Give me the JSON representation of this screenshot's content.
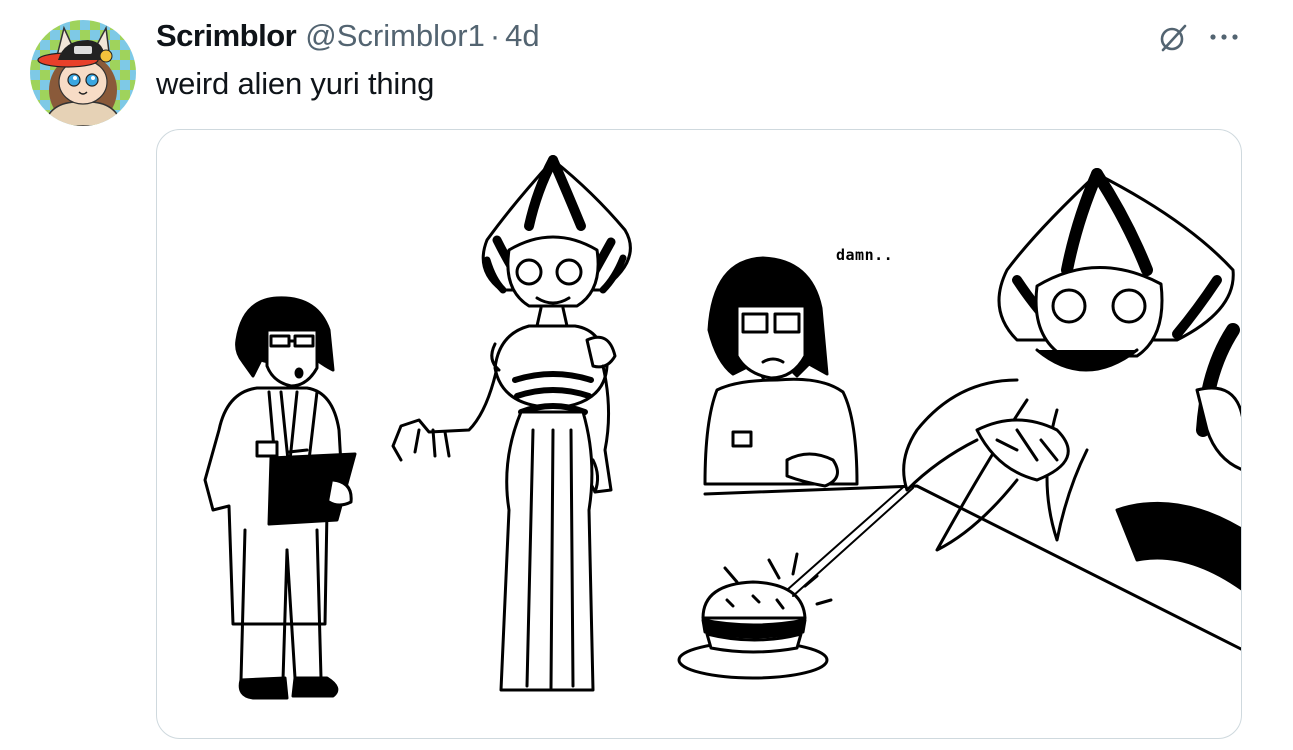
{
  "tweet": {
    "display_name": "Scrimblor",
    "handle": "@Scrimblor1",
    "separator": "·",
    "time": "4d",
    "text": "weird alien yuri thing"
  },
  "media": {
    "speech_text": "damn.."
  },
  "icons": {
    "avatar": "cartoon-fox-girl-avatar",
    "grok": "grok-icon",
    "more": "more-options-icon"
  },
  "colors": {
    "text_primary": "#0f1419",
    "text_secondary": "#536471",
    "border": "#cfd9de"
  }
}
